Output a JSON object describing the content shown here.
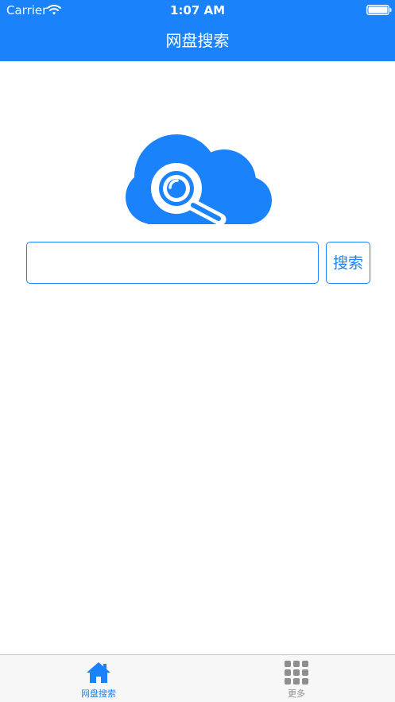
{
  "status_bar": {
    "carrier": "Carrier",
    "time": "1:07 AM",
    "icons": [
      "wifi-icon",
      "battery-icon"
    ]
  },
  "nav": {
    "title": "网盘搜索"
  },
  "logo": {
    "icon": "cloud-search-icon"
  },
  "search": {
    "input_value": "",
    "placeholder": "",
    "button_label": "搜索"
  },
  "tab_bar": {
    "tabs": [
      {
        "label": "网盘搜索",
        "icon": "home-icon",
        "active": true
      },
      {
        "label": "更多",
        "icon": "grid-icon",
        "active": false
      }
    ]
  },
  "colors": {
    "brand": "#1a82fb",
    "tab_inactive": "#8e8e8e",
    "tab_bar_bg": "#f7f7f7"
  }
}
